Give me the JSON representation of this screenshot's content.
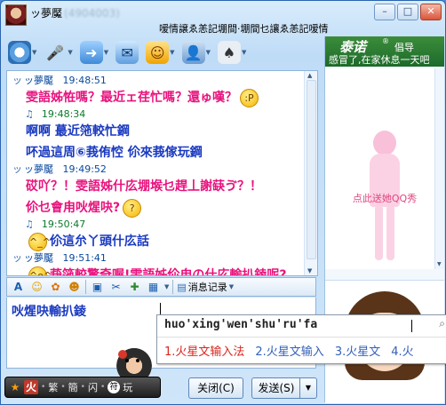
{
  "window": {
    "nickname": "ッ夢魘",
    "qq_number": "(4904003)",
    "signature": "嗳情譲ゑ恙記堋間‧堋間乜讓ゑ恙記嗳情",
    "controls": [
      "minimize",
      "maximize",
      "close"
    ]
  },
  "toolbar": {
    "items": [
      {
        "name": "video-chat",
        "icon": "camera-icon"
      },
      {
        "name": "voice-chat",
        "icon": "microphone-icon"
      },
      {
        "name": "send-file",
        "icon": "folder-icon"
      },
      {
        "name": "send-sms",
        "icon": "sms-icon"
      },
      {
        "name": "apps",
        "icon": "app-icon"
      },
      {
        "name": "more",
        "icon": "more-icon"
      }
    ]
  },
  "chat": {
    "messages": [
      {
        "sender": "ッ夢魘",
        "time": "19:48:51",
        "side": "them",
        "text": "雯語姊恠嗎？最近ェ荏忙嗎？還ゅ嘆？",
        "emoji": "tongue"
      },
      {
        "sender": "",
        "time": "19:48:34",
        "side": "me",
        "text": "啊啊  蕞近筂較忙鋼",
        "emoji": ""
      },
      {
        "sender": "",
        "time": "",
        "side": "me",
        "text": "吥過這周⑥莪侑悾  伱來莪傢玩鋼",
        "emoji": ""
      },
      {
        "sender": "ッ夢魘",
        "time": "19:49:52",
        "side": "them",
        "text": "砹吖？！雯語姊什庅堋堠乜趕丄謝蒛ゔ？！",
        "emoji": ""
      },
      {
        "sender": "",
        "time": "",
        "side": "them",
        "text": "伱乜會甪吙煋吷?",
        "emoji": "thinking"
      },
      {
        "sender": "",
        "time": "19:50:47",
        "side": "me",
        "text": "伱這厼丫頭什庅話",
        "emoji": "grin"
      },
      {
        "sender": "ッ夢魘",
        "time": "19:51:41",
        "side": "them",
        "text": "莪筂較驚奇喔!雯語姊伱甪の什庅輸扒錂呢?",
        "emoji": "smile"
      }
    ]
  },
  "input_toolbar": {
    "history_label": "消息记录"
  },
  "input": {
    "text": "吙煋吷輸扒錂"
  },
  "buttons": {
    "close_label": "关闭(C)",
    "send_label": "发送(S)"
  },
  "ime": {
    "mode": "火",
    "items": [
      "繁",
      "簡",
      "闪",
      "符",
      "玩"
    ],
    "pinyin": "huo'xing'wen'shu'ru'fa",
    "candidates": [
      "1.火星文输入法",
      "2.火星文输入",
      "3.火星文",
      "4.火"
    ]
  },
  "ad": {
    "brand": "泰诺",
    "reg": "®",
    "tag": "倡导",
    "slogan": "感冒了,在家休息一天吧"
  },
  "qqshow": {
    "label": "点此送她QQ秀"
  }
}
